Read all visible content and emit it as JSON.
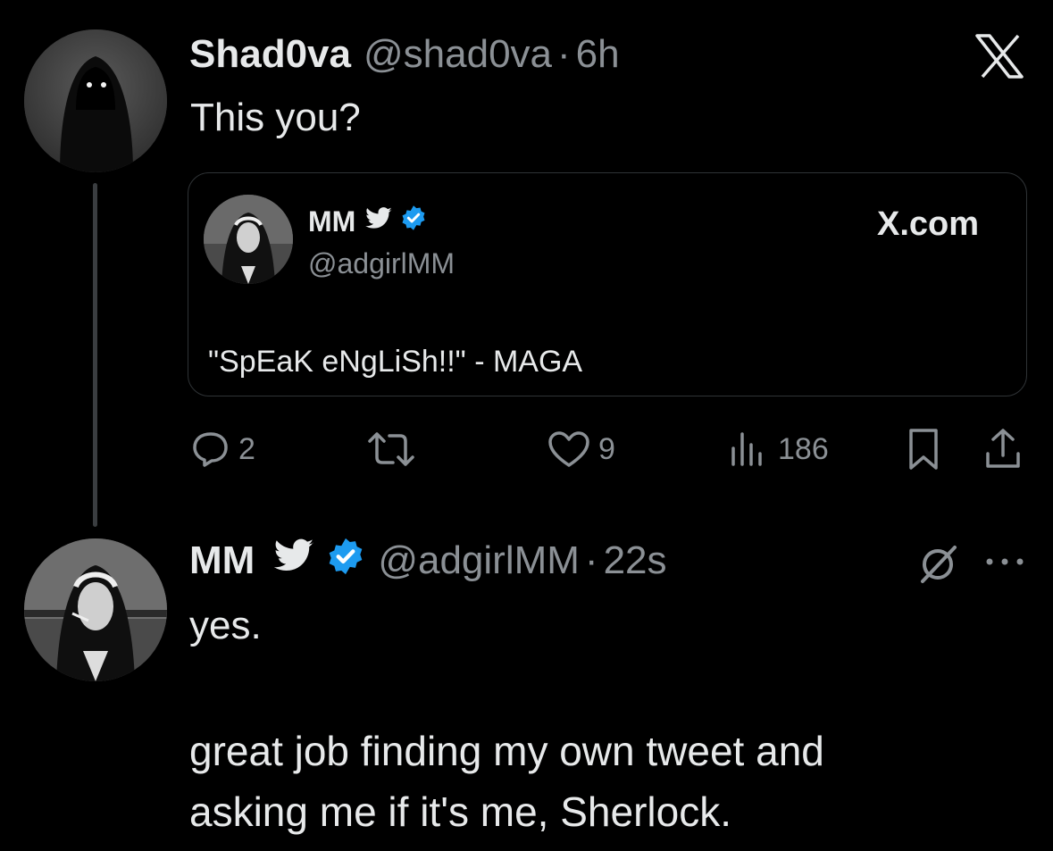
{
  "colors": {
    "background": "#000000",
    "text": "#e7e9ea",
    "muted": "#8b9095",
    "verified": "#1d9bf0",
    "border": "#2f3336"
  },
  "tweet1": {
    "display_name": "Shad0va",
    "handle": "@shad0va",
    "separator": "·",
    "time": "6h",
    "text": "This you?",
    "platform_icon": "x-logo-icon"
  },
  "quote": {
    "display_name": "MM",
    "handle": "@adgirlMM",
    "source": "X.com",
    "text": "\"SpEaK eNgLiSh!!\" - MAGA"
  },
  "actions": {
    "replies": "2",
    "retweets": "",
    "likes": "9",
    "views": "186"
  },
  "tweet2": {
    "display_name": "MM",
    "handle": "@adgirlMM",
    "separator": "·",
    "time": "22s",
    "line1": "yes.",
    "line2": "great job finding my own tweet and",
    "line3": "asking me if it's me, Sherlock."
  }
}
